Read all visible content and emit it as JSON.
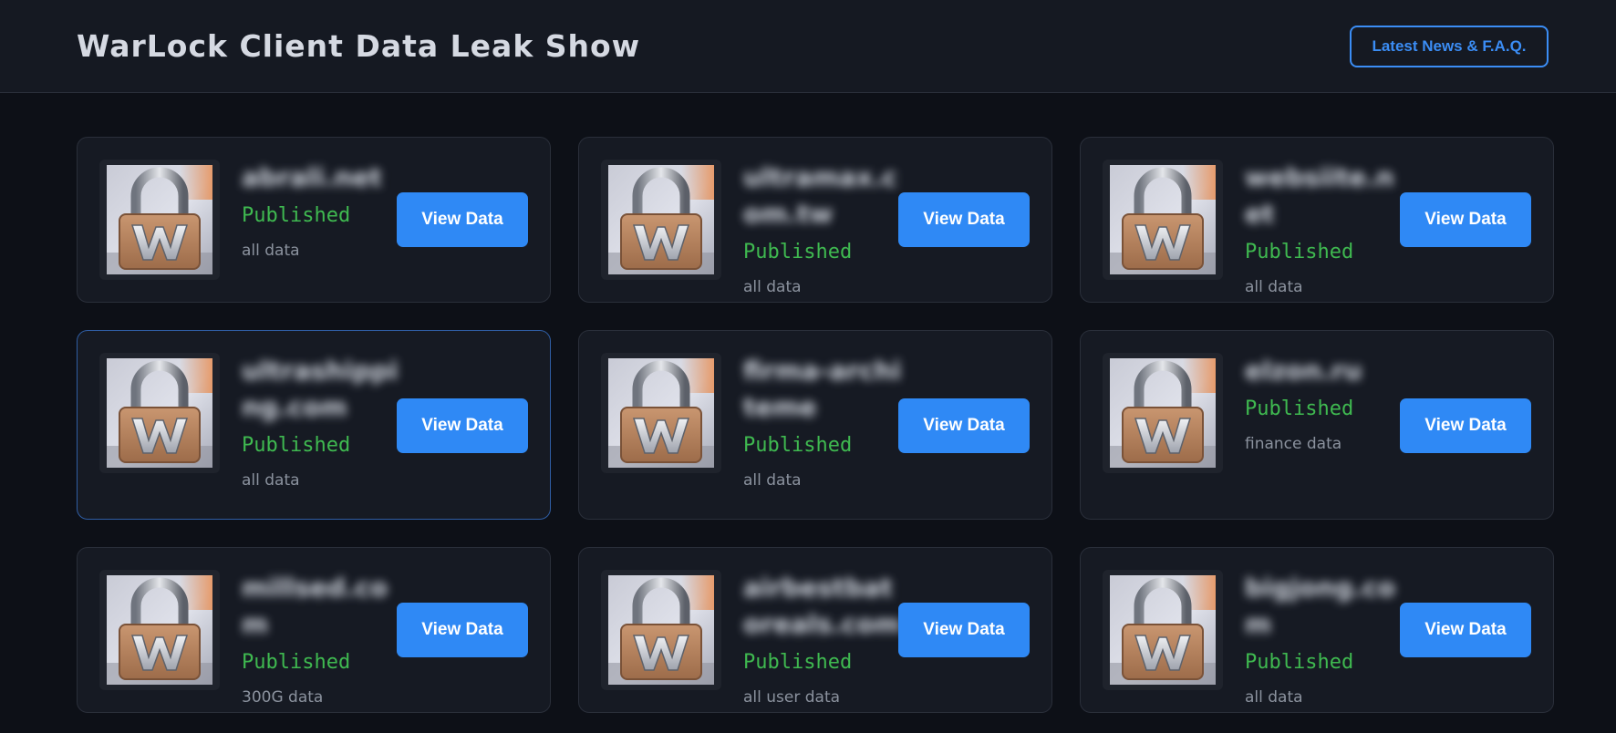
{
  "header": {
    "title": "WarLock Client Data Leak Show",
    "news_label": "Latest News & F.A.Q."
  },
  "colors": {
    "accent": "#2f89f5",
    "published": "#3fb950",
    "background": "#0d1017",
    "card": "#161a23"
  },
  "cards": [
    {
      "domain": "abrali.net",
      "status": "Published",
      "description": "all data",
      "button": "View Data",
      "icon": "padlock-w-icon"
    },
    {
      "domain": "ultramax.com.tw",
      "status": "Published",
      "description": "all data",
      "button": "View Data",
      "icon": "padlock-w-icon"
    },
    {
      "domain": "websiite.net",
      "status": "Published",
      "description": "all data",
      "button": "View Data",
      "icon": "padlock-w-icon"
    },
    {
      "domain": "ultrashipping.com",
      "status": "Published",
      "description": "all data",
      "button": "View Data",
      "icon": "padlock-w-icon"
    },
    {
      "domain": "firma-architeme",
      "status": "Published",
      "description": "all data",
      "button": "View Data",
      "icon": "padlock-w-icon"
    },
    {
      "domain": "elzon.ru",
      "status": "Published",
      "description": "finance data",
      "button": "View Data",
      "icon": "padlock-w-icon"
    },
    {
      "domain": "millsed.com",
      "status": "Published",
      "description": "300G data",
      "button": "View Data",
      "icon": "padlock-w-icon"
    },
    {
      "domain": "airbestbatoreals.com",
      "status": "Published",
      "description": "all user data",
      "button": "View Data",
      "icon": "padlock-w-icon"
    },
    {
      "domain": "bigjong.com",
      "status": "Published",
      "description": "all data",
      "button": "View Data",
      "icon": "padlock-w-icon"
    }
  ]
}
